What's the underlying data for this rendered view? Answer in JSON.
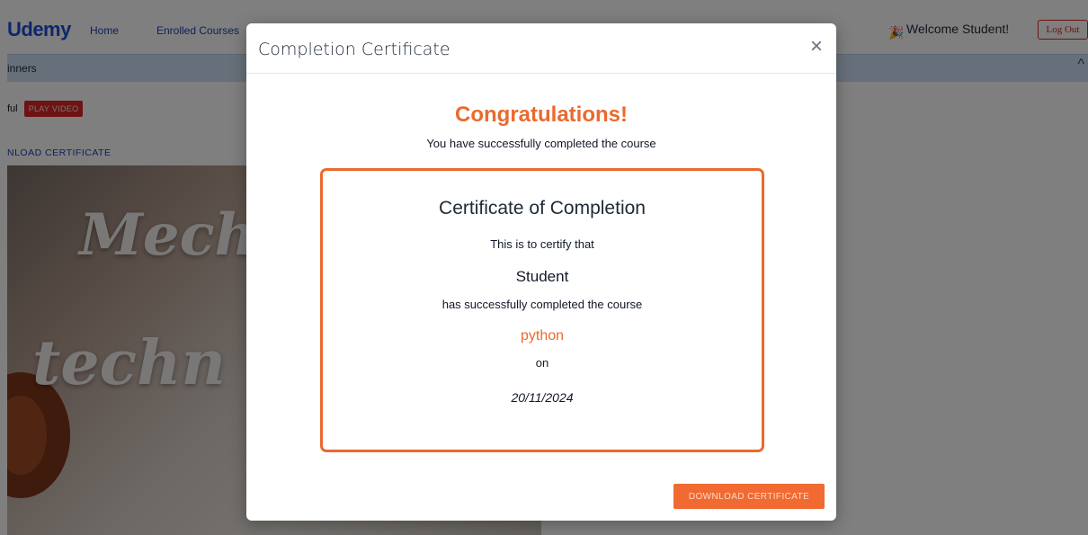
{
  "navbar": {
    "brand": "Udemy",
    "home": "Home",
    "enrolled_courses": "Enrolled Courses",
    "welcome_icon": "🎉",
    "welcome": "Welcome Student!",
    "logout": "Log Out"
  },
  "course_bar": {
    "title": "inners",
    "chevron": "^"
  },
  "lesson": {
    "text": "ful",
    "play_label": "PLAY VIDEO"
  },
  "download_link": "NLOAD CERTIFICATE",
  "thumbnail": {
    "word1": "Mech",
    "word2": "techn"
  },
  "modal": {
    "title": "Completion Certificate",
    "close": "×",
    "congrats": "Congratulations!",
    "subtext": "You have successfully completed the course",
    "certificate": {
      "heading": "Certificate of Completion",
      "line1": "This is to certify that",
      "name": "Student",
      "line2": "has successfully completed the course",
      "course": "python",
      "on": "on",
      "date": "20/11/2024"
    },
    "download_button": "DOWNLOAD CERTIFICATE"
  },
  "colors": {
    "accent": "#ea6a2e",
    "brand": "#1d4ed8",
    "danger": "#dc2626"
  }
}
